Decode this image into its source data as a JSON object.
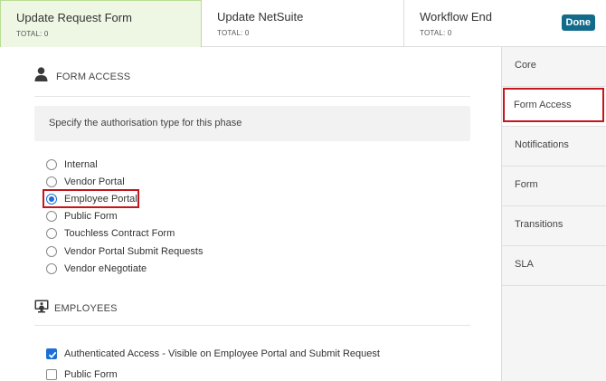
{
  "tabs": [
    {
      "title": "Update Request Form",
      "total": "TOTAL: 0"
    },
    {
      "title": "Update NetSuite",
      "total": "TOTAL: 0"
    },
    {
      "title": "Workflow End",
      "total": "TOTAL: 0",
      "badge": "Done"
    }
  ],
  "form_access": {
    "icon": "user-icon",
    "heading": "FORM ACCESS",
    "hint": "Specify the authorisation type for this phase",
    "options": [
      {
        "label": "Internal",
        "selected": false
      },
      {
        "label": "Vendor Portal",
        "selected": false
      },
      {
        "label": "Employee Portal",
        "selected": true
      },
      {
        "label": "Public Form",
        "selected": false
      },
      {
        "label": "Touchless Contract Form",
        "selected": false
      },
      {
        "label": "Vendor Portal Submit Requests",
        "selected": false
      },
      {
        "label": "Vendor eNegotiate",
        "selected": false
      }
    ]
  },
  "employees": {
    "icon": "monitor-user-icon",
    "heading": "EMPLOYEES",
    "options": [
      {
        "label": "Authenticated Access - Visible on Employee Portal and Submit Request",
        "checked": true
      },
      {
        "label": "Public Form",
        "checked": false
      }
    ]
  },
  "side_nav": {
    "items": [
      "Core",
      "Form Access",
      "Notifications",
      "Form",
      "Transitions",
      "SLA"
    ],
    "active": "Form Access"
  },
  "colors": {
    "accent": "#1c6fd6",
    "badge": "#136b8c",
    "highlight": "#c4161c",
    "active_tab_bg": "#eef7e4"
  }
}
